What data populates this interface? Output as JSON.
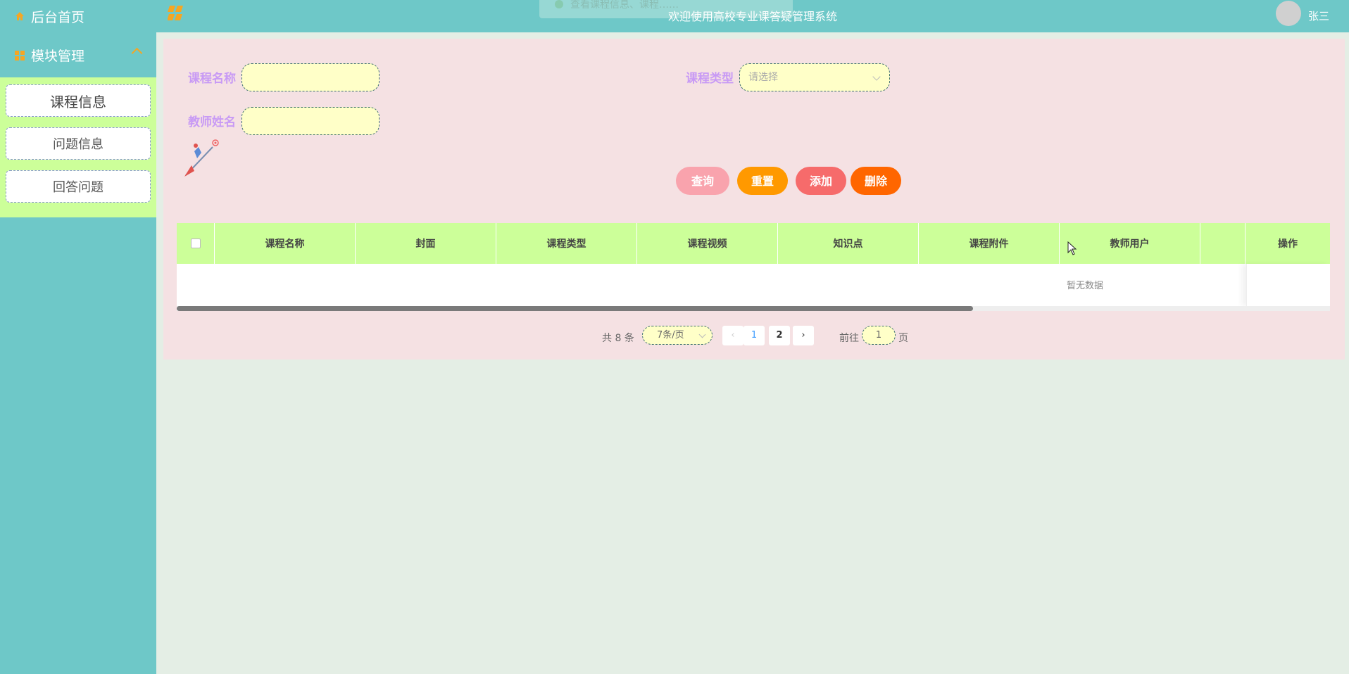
{
  "sidebar": {
    "home_label": "后台首页",
    "module_label": "模块管理",
    "items": [
      {
        "label": "课程信息"
      },
      {
        "label": "问题信息"
      },
      {
        "label": "回答问题"
      }
    ]
  },
  "header": {
    "title": "欢迎使用高校专业课答疑管理系统",
    "toast": "查看课程信息、课程……",
    "username": "张三"
  },
  "search": {
    "course_name_label": "课程名称",
    "course_name_value": "",
    "course_type_label": "课程类型",
    "course_type_placeholder": "请选择",
    "teacher_name_label": "教师姓名",
    "teacher_name_value": ""
  },
  "buttons": {
    "query": "查询",
    "reset": "重置",
    "add": "添加",
    "delete": "删除"
  },
  "table": {
    "columns": [
      "课程名称",
      "封面",
      "课程类型",
      "课程视频",
      "知识点",
      "课程附件",
      "教师用户",
      "",
      "操作"
    ],
    "empty_text": "暂无数据"
  },
  "pagination": {
    "total_text": "共 8 条",
    "page_size": "7条/页",
    "pages": [
      "1",
      "2"
    ],
    "current_page": "1",
    "goto_label": "前往",
    "goto_value": "1",
    "goto_unit": "页"
  },
  "colors": {
    "teal": "#6ec8c8",
    "sub_menu_bg": "#ccff99",
    "panel_bg": "#f5e1e3",
    "label_purple": "#c89af5",
    "input_bg": "#ffffc8",
    "btn_query": "#f9a3ad",
    "btn_reset": "#ff9900",
    "btn_add": "#f66b6b",
    "btn_delete": "#ff6600"
  }
}
